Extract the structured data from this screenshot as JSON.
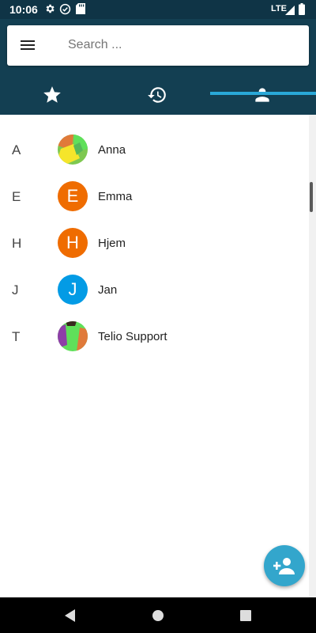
{
  "status_bar": {
    "time": "10:06",
    "network": "LTE",
    "icons": [
      "gear-icon",
      "check-circle-icon",
      "sd-card-icon",
      "signal-icon",
      "battery-icon"
    ]
  },
  "search": {
    "placeholder": "Search ...",
    "menu_icon": "hamburger-menu-icon"
  },
  "tabs": [
    {
      "icon": "star-icon",
      "selected": false
    },
    {
      "icon": "history-icon",
      "selected": false
    },
    {
      "icon": "person-icon",
      "selected": true
    }
  ],
  "contacts": [
    {
      "letter": "A",
      "name": "Anna",
      "avatar": "image"
    },
    {
      "letter": "E",
      "name": "Emma",
      "avatar": "initial",
      "initial": "E",
      "color": "#ef6c00"
    },
    {
      "letter": "H",
      "name": "Hjem",
      "avatar": "initial",
      "initial": "H",
      "color": "#ef6c00"
    },
    {
      "letter": "J",
      "name": "Jan",
      "avatar": "initial",
      "initial": "J",
      "color": "#039be5"
    },
    {
      "letter": "T",
      "name": "Telio Support",
      "avatar": "image"
    }
  ],
  "fab": {
    "icon": "add-person-icon"
  },
  "colors": {
    "appbar": "#133f52",
    "statusbar": "#0f3446",
    "accent": "#29a8d8",
    "fab": "#33a6cc"
  }
}
